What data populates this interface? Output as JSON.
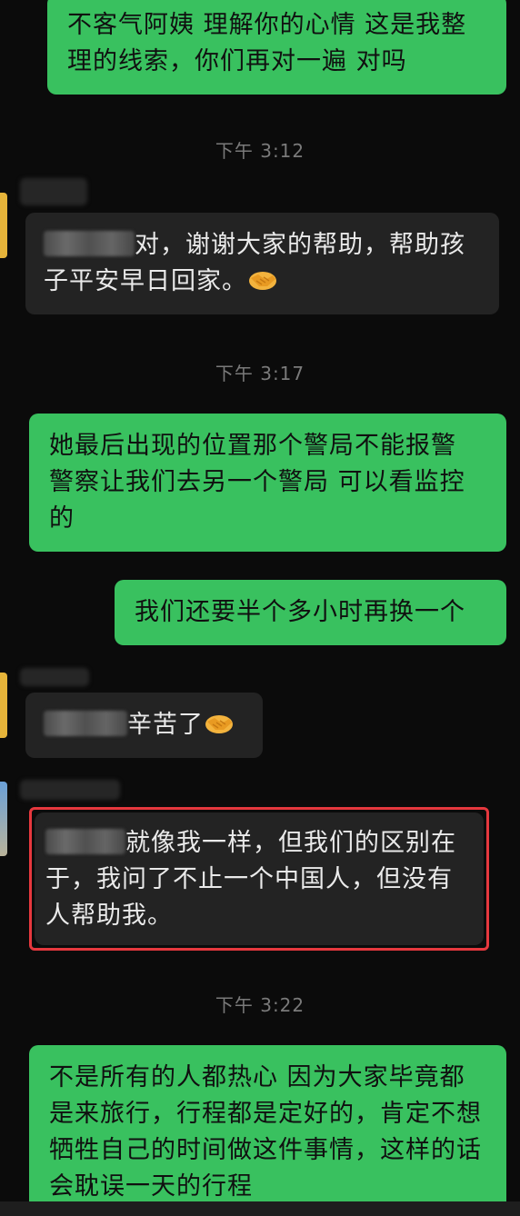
{
  "messages": {
    "m1": "不客气阿姨 理解你的心情 这是我整理的线索，你们再对一遍 对吗",
    "t1": "下午 3:12",
    "m2": "对，谢谢大家的帮助，帮助孩子平安早日回家。",
    "t2": "下午 3:17",
    "m3": "她最后出现的位置那个警局不能报警 警察让我们去另一个警局 可以看监控的",
    "m4": "我们还要半个多小时再换一个",
    "m5": "辛苦了",
    "m6": "就像我一样，但我们的区别在于，我问了不止一个中国人，但没有人帮助我。",
    "t3": "下午 3:22",
    "m7": "不是所有的人都热心 因为大家毕竟都是来旅行，行程都是定好的，肯定不想牺牲自己的时间做这件事情，这样的话会耽误一天的行程"
  },
  "icons": {
    "handshake": "handshake-emoji"
  },
  "colors": {
    "background": "#0b0b0b",
    "outgoing_bubble": "#39c15f",
    "incoming_bubble": "#232323",
    "timestamp": "#7a7a7a",
    "highlight_border": "#e6383e"
  }
}
